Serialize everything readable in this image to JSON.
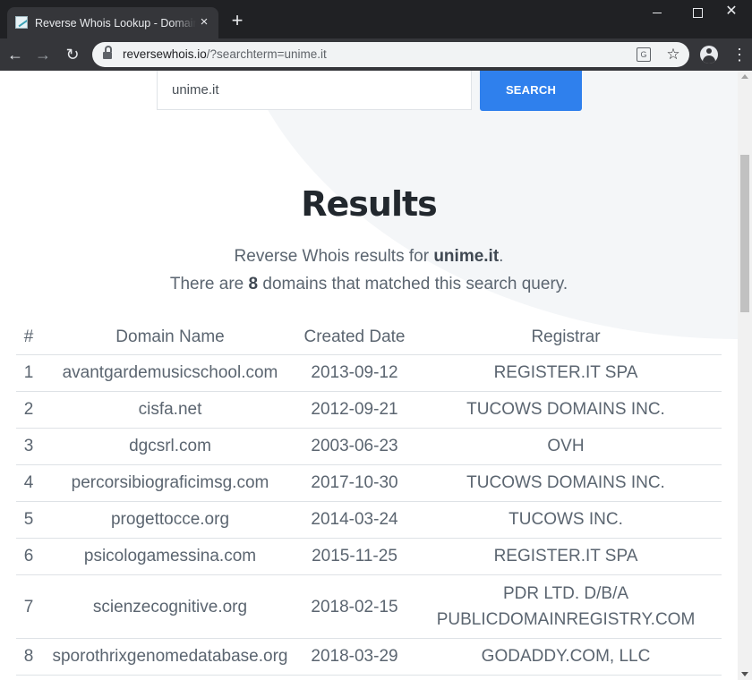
{
  "browser": {
    "tab_title": "Reverse Whois Lookup - Domain",
    "tab_favicon": "reversewhois-favicon",
    "url_host": "reversewhois.io",
    "url_path": "/?searchterm=unime.it",
    "icons": {
      "close_tab": "×",
      "new_tab": "+",
      "window_close": "✕",
      "back": "←",
      "forward": "→",
      "reload": "↻",
      "translate": "G",
      "star": "☆",
      "menu": "⋮"
    }
  },
  "search": {
    "value": "unime.it",
    "button_label": "SEARCH"
  },
  "results": {
    "title": "Results",
    "summary_prefix": "Reverse Whois results for ",
    "term": "unime.it",
    "summary_suffix": ".",
    "count_prefix": "There are ",
    "count": "8",
    "count_suffix": " domains that matched this search query.",
    "columns": [
      "#",
      "Domain Name",
      "Created Date",
      "Registrar"
    ],
    "rows": [
      {
        "num": "1",
        "domain": "avantgardemusicschool.com",
        "created": "2013-09-12",
        "registrar": "REGISTER.IT SPA"
      },
      {
        "num": "2",
        "domain": "cisfa.net",
        "created": "2012-09-21",
        "registrar": "TUCOWS DOMAINS INC."
      },
      {
        "num": "3",
        "domain": "dgcsrl.com",
        "created": "2003-06-23",
        "registrar": "OVH"
      },
      {
        "num": "4",
        "domain": "percorsibiograficimsg.com",
        "created": "2017-10-30",
        "registrar": "TUCOWS DOMAINS INC."
      },
      {
        "num": "5",
        "domain": "progettocce.org",
        "created": "2014-03-24",
        "registrar": "TUCOWS INC."
      },
      {
        "num": "6",
        "domain": "psicologamessina.com",
        "created": "2015-11-25",
        "registrar": "REGISTER.IT SPA"
      },
      {
        "num": "7",
        "domain": "scienzecognitive.org",
        "created": "2018-02-15",
        "registrar_line1": "PDR LTD. D/B/A",
        "registrar_line2": "PUBLICDOMAINREGISTRY.COM"
      },
      {
        "num": "8",
        "domain": "sporothrixgenomedatabase.org",
        "created": "2018-03-29",
        "registrar": "GODADDY.COM, LLC"
      }
    ]
  },
  "colors": {
    "accent": "#2f80ed",
    "heading": "#22282e",
    "text": "#5b6570",
    "chrome_dark": "#202124",
    "chrome_toolbar": "#35363a"
  }
}
